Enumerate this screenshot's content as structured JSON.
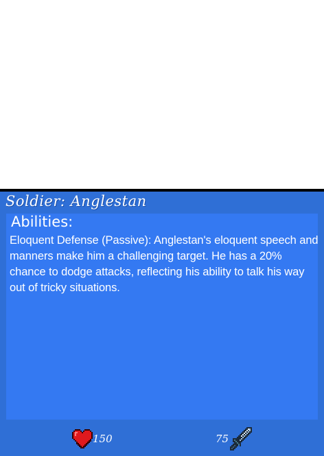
{
  "unit": {
    "title": "Soldier: Anglestan"
  },
  "abilities": {
    "heading": "Abilities:",
    "description": "Eloquent Defense (Passive): Anglestan's eloquent speech and manners make him a challenging target. He has a 20% chance to dodge attacks, reflecting his ability to talk his way out of tricky situations."
  },
  "stats": {
    "health": {
      "icon": "heart-icon",
      "value": "150"
    },
    "attack": {
      "icon": "sword-icon",
      "value": "75"
    }
  },
  "colors": {
    "card_background": "#2f6fd6",
    "panel_background": "#3479f2",
    "border": "#000000",
    "text": "#ffffff",
    "heart": "#e0191e"
  }
}
